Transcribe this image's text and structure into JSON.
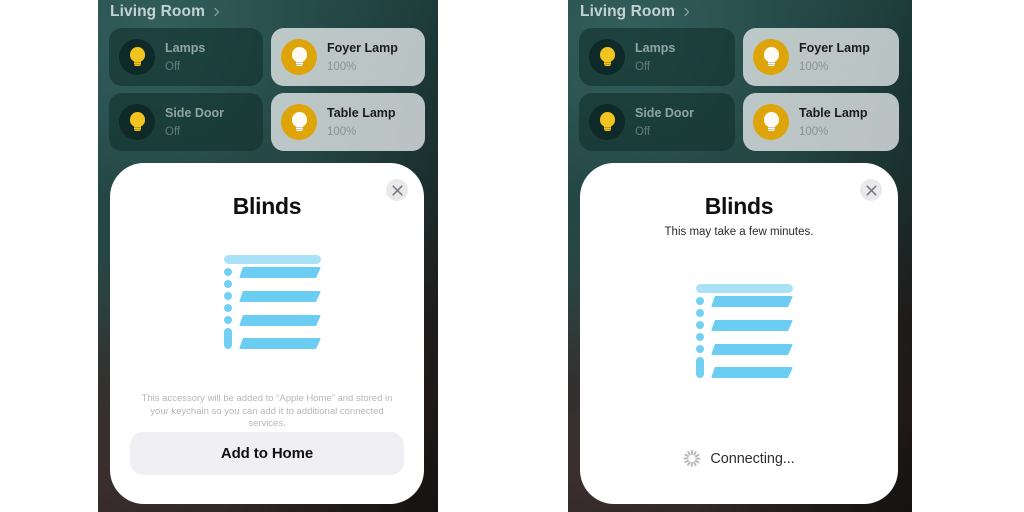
{
  "room": {
    "title": "Living Room",
    "chevron_icon": "chevron-right-icon"
  },
  "devices": [
    {
      "name": "Lamps",
      "state": "Off",
      "status": "off",
      "icon": "lightbulb-icon"
    },
    {
      "name": "Foyer Lamp",
      "state": "100%",
      "status": "on",
      "icon": "lightbulb-icon"
    },
    {
      "name": "Side Door",
      "state": "Off",
      "status": "off",
      "icon": "lightbulb-icon"
    },
    {
      "name": "Table Lamp",
      "state": "100%",
      "status": "on",
      "icon": "lightbulb-icon"
    }
  ],
  "left_sheet": {
    "title": "Blinds",
    "close_icon": "close-icon",
    "accessory_icon": "window-blinds-icon",
    "disclaimer": "This accessory will be added to “Apple Home” and stored in your keychain so you can add it to additional connected services.",
    "primary_button": "Add to Home"
  },
  "right_sheet": {
    "title": "Blinds",
    "subtitle": "This may take a few minutes.",
    "close_icon": "close-icon",
    "accessory_icon": "window-blinds-icon",
    "status_icon": "spinner-icon",
    "status_label": "Connecting..."
  },
  "colors": {
    "blinds_rail": "#a9e1f7",
    "blinds_slat": "#6ccdf3",
    "bulb_on_circle": "#dda509",
    "bulb_off_glow": "#f2c41f",
    "sheet_bg": "#ffffff",
    "button_bg": "#f0f0f4",
    "page_bg": "#ffffff"
  }
}
